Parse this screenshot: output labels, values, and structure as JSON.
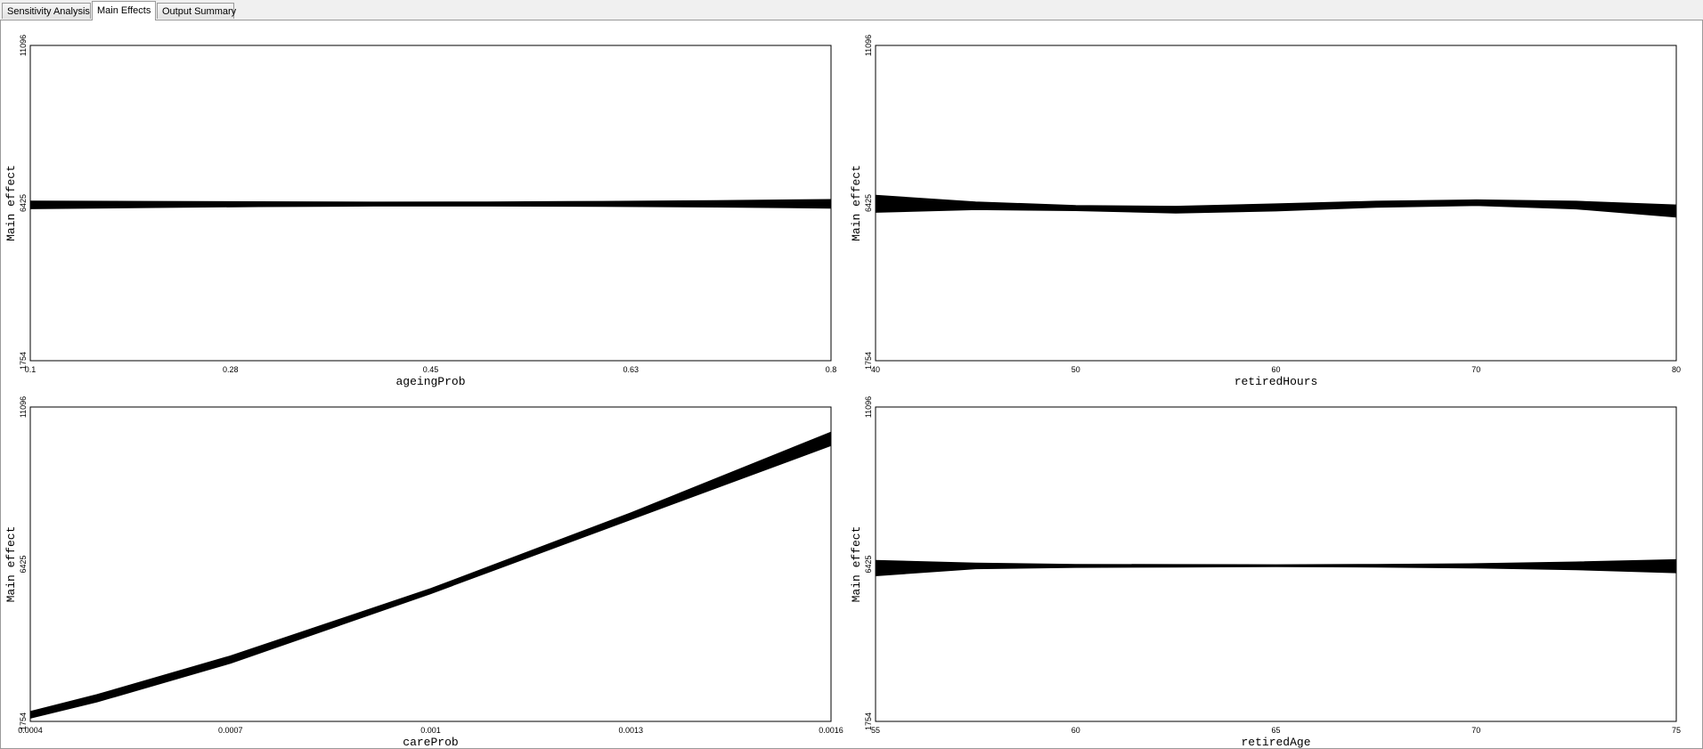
{
  "tabs": [
    {
      "label": "Sensitivity Analysis",
      "active": false
    },
    {
      "label": "Main Effects",
      "active": true
    },
    {
      "label": "Output Summary",
      "active": false
    }
  ],
  "chart_data": [
    {
      "type": "line",
      "xlabel": "ageingProb",
      "ylabel": "Main effect",
      "x_ticks": [
        "0.1",
        "0.28",
        "0.45",
        "0.63",
        "0.8"
      ],
      "y_ticks": [
        "1754",
        "6425",
        "11096"
      ],
      "xlim": [
        0.1,
        0.8
      ],
      "ylim": [
        1754,
        11096
      ],
      "grid": false,
      "x": [
        0.1,
        0.2,
        0.3,
        0.4,
        0.5,
        0.6,
        0.7,
        0.8
      ],
      "band": {
        "upper": [
          6487,
          6475,
          6465,
          6455,
          6460,
          6475,
          6500,
          6530
        ],
        "lower": [
          6255,
          6290,
          6320,
          6335,
          6335,
          6325,
          6305,
          6275
        ]
      }
    },
    {
      "type": "line",
      "xlabel": "retiredHours",
      "ylabel": "Main effect",
      "x_ticks": [
        "40",
        "50",
        "60",
        "70",
        "80"
      ],
      "y_ticks": [
        "1754",
        "6425",
        "11096"
      ],
      "xlim": [
        40,
        80
      ],
      "ylim": [
        1754,
        11096
      ],
      "grid": false,
      "x": [
        40,
        45,
        50,
        55,
        60,
        65,
        70,
        75,
        80
      ],
      "band": {
        "upper": [
          6655,
          6460,
          6350,
          6330,
          6400,
          6480,
          6520,
          6480,
          6370
        ],
        "lower": [
          6150,
          6230,
          6200,
          6130,
          6190,
          6300,
          6350,
          6250,
          6010
        ]
      }
    },
    {
      "type": "line",
      "xlabel": "careProb",
      "ylabel": "Main effect",
      "x_ticks": [
        "0.0004",
        "0.0007",
        "0.001",
        "0.0013",
        "0.0016"
      ],
      "y_ticks": [
        "1754",
        "6425",
        "11096"
      ],
      "xlim": [
        0.0004,
        0.0016
      ],
      "ylim": [
        1754,
        11096
      ],
      "grid": false,
      "x": [
        0.0004,
        0.0005,
        0.0007,
        0.001,
        0.0013,
        0.0016
      ],
      "band": {
        "upper": [
          2050,
          2550,
          3700,
          5700,
          7950,
          10350
        ],
        "lower": [
          1850,
          2330,
          3480,
          5550,
          7750,
          9950
        ]
      }
    },
    {
      "type": "line",
      "xlabel": "retiredAge",
      "ylabel": "Main effect",
      "x_ticks": [
        "55",
        "60",
        "65",
        "70",
        "75"
      ],
      "y_ticks": [
        "1754",
        "6425",
        "11096"
      ],
      "xlim": [
        55,
        75
      ],
      "ylim": [
        1754,
        11096
      ],
      "grid": false,
      "x": [
        55,
        57.5,
        60,
        62.5,
        65,
        67.5,
        70,
        72.5,
        75
      ],
      "band": {
        "upper": [
          6540,
          6460,
          6420,
          6415,
          6410,
          6420,
          6440,
          6490,
          6560
        ],
        "lower": [
          6080,
          6290,
          6330,
          6340,
          6350,
          6340,
          6310,
          6260,
          6170
        ]
      }
    }
  ]
}
